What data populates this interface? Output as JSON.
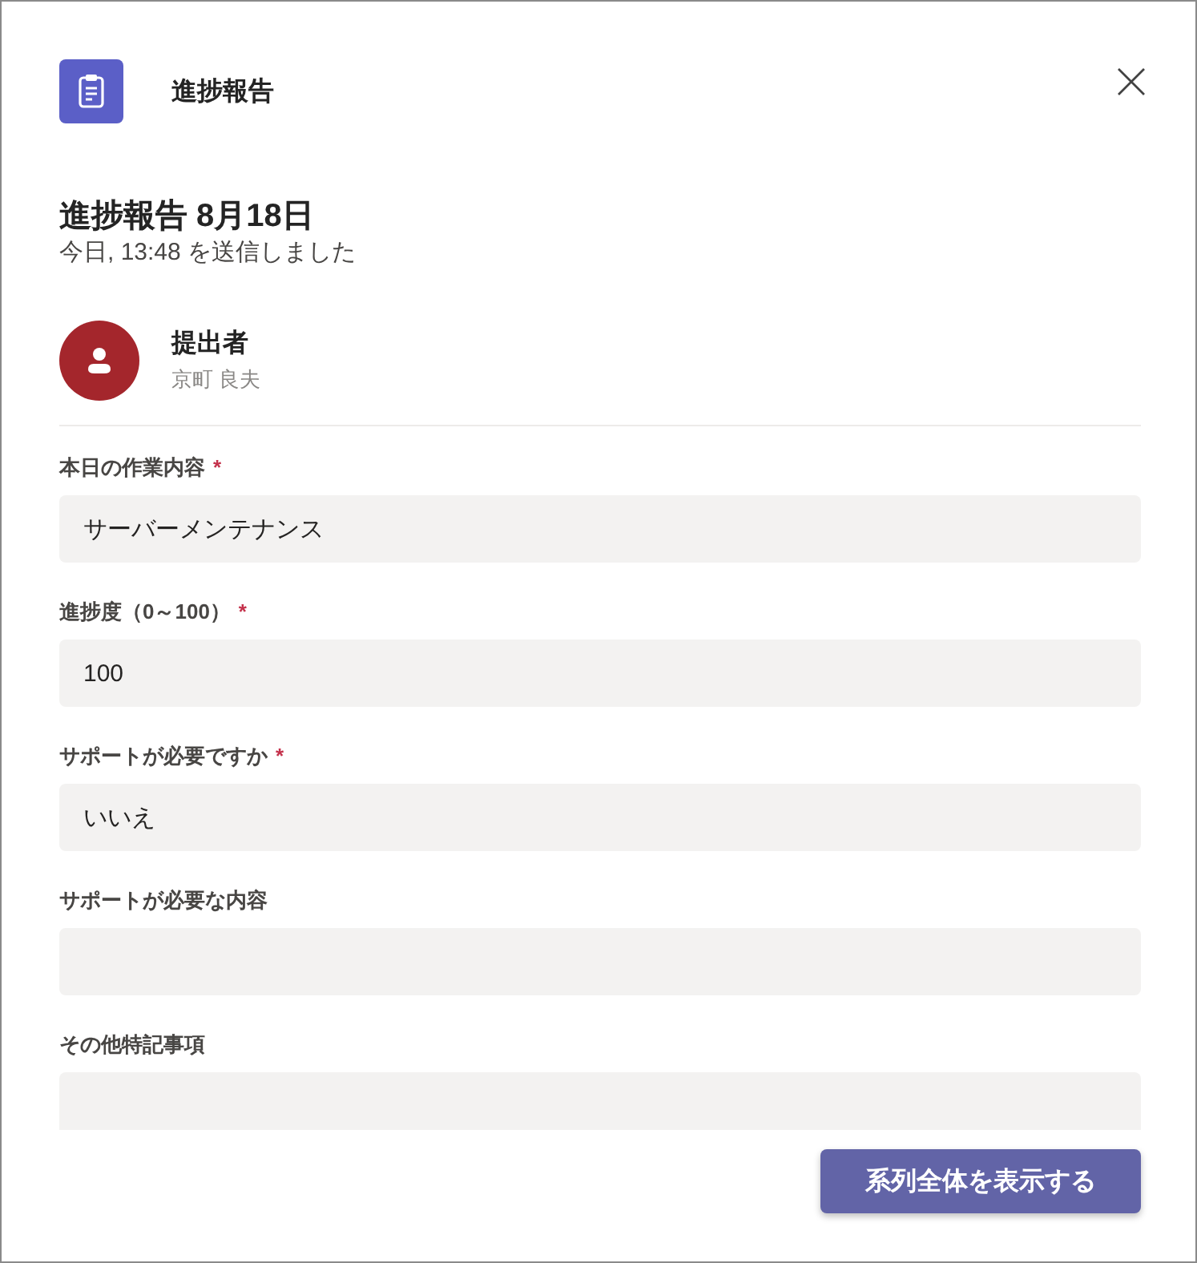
{
  "header": {
    "app_name": "進捗報告"
  },
  "card": {
    "title": "進捗報告 8月18日",
    "subtitle": "今日, 13:48 を送信しました",
    "submitter": {
      "label": "提出者",
      "name": "京町 良夫"
    },
    "fields": [
      {
        "label": "本日の作業内容",
        "required_mark": "*",
        "value": "サーバーメンテナンス"
      },
      {
        "label": "進捗度（0～100）",
        "required_mark": "*",
        "value": "100"
      },
      {
        "label": "サポートが必要ですか",
        "required_mark": "*",
        "value": "いいえ"
      },
      {
        "label": "サポートが必要な内容"
      },
      {
        "label": "その他特記事項"
      }
    ]
  },
  "footer": {
    "button": "系列全体を表示する"
  }
}
